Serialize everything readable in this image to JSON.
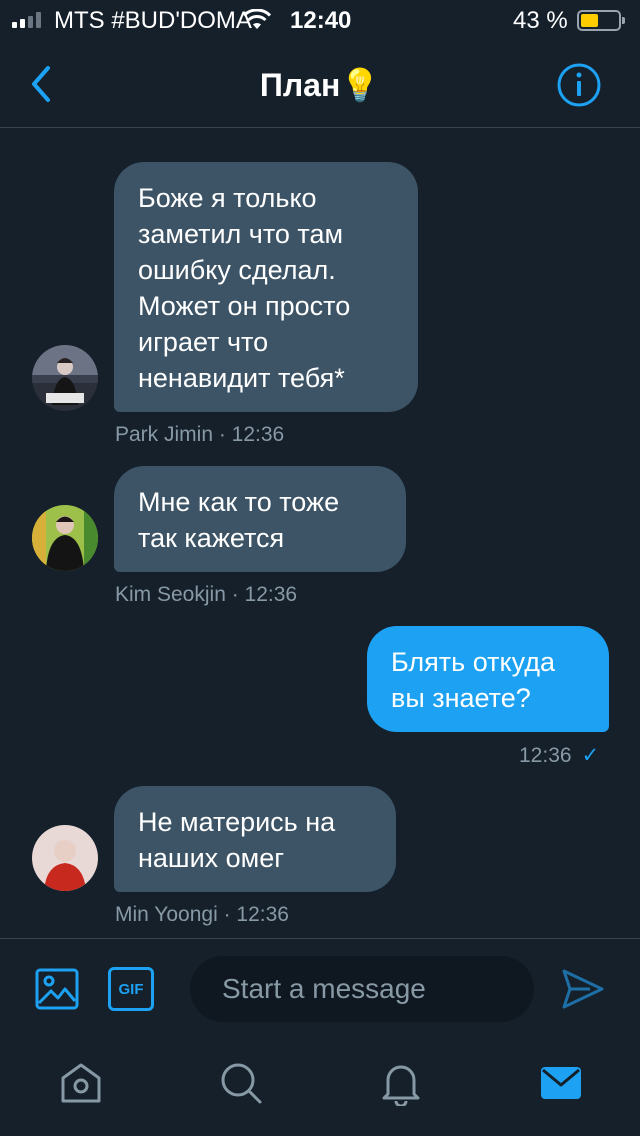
{
  "status_bar": {
    "carrier": "MTS #BUD'DOMA",
    "time": "12:40",
    "battery": "43 %",
    "battery_level": 0.43
  },
  "header": {
    "title": "План💡",
    "back_icon": "chevron-left-icon",
    "info_icon": "info-icon"
  },
  "messages": [
    {
      "direction": "incoming",
      "lines": [
        "Боже я только",
        "заметил что там",
        "ошибку сделал.",
        "Может он просто",
        "играет что",
        "ненавидит тебя*"
      ],
      "meta": "Park Jimin · 12:36"
    },
    {
      "direction": "incoming",
      "lines": [
        "Мне как то тоже",
        "так кажется"
      ],
      "meta": "Kim Seokjin · 12:36"
    },
    {
      "direction": "outgoing",
      "lines": [
        "Блять откуда",
        "вы знаете?"
      ],
      "meta": "12:36",
      "status": "✓"
    },
    {
      "direction": "incoming",
      "lines": [
        "Не матерись на",
        "наших омег"
      ],
      "meta": "Min Yoongi · 12:36"
    }
  ],
  "composer": {
    "placeholder": "Start a message",
    "gif_label": "GIF"
  },
  "colors": {
    "background": "#15202b",
    "accent": "#1da1f2",
    "incoming_bubble": "#3d5466",
    "muted_text": "#8899a6"
  }
}
